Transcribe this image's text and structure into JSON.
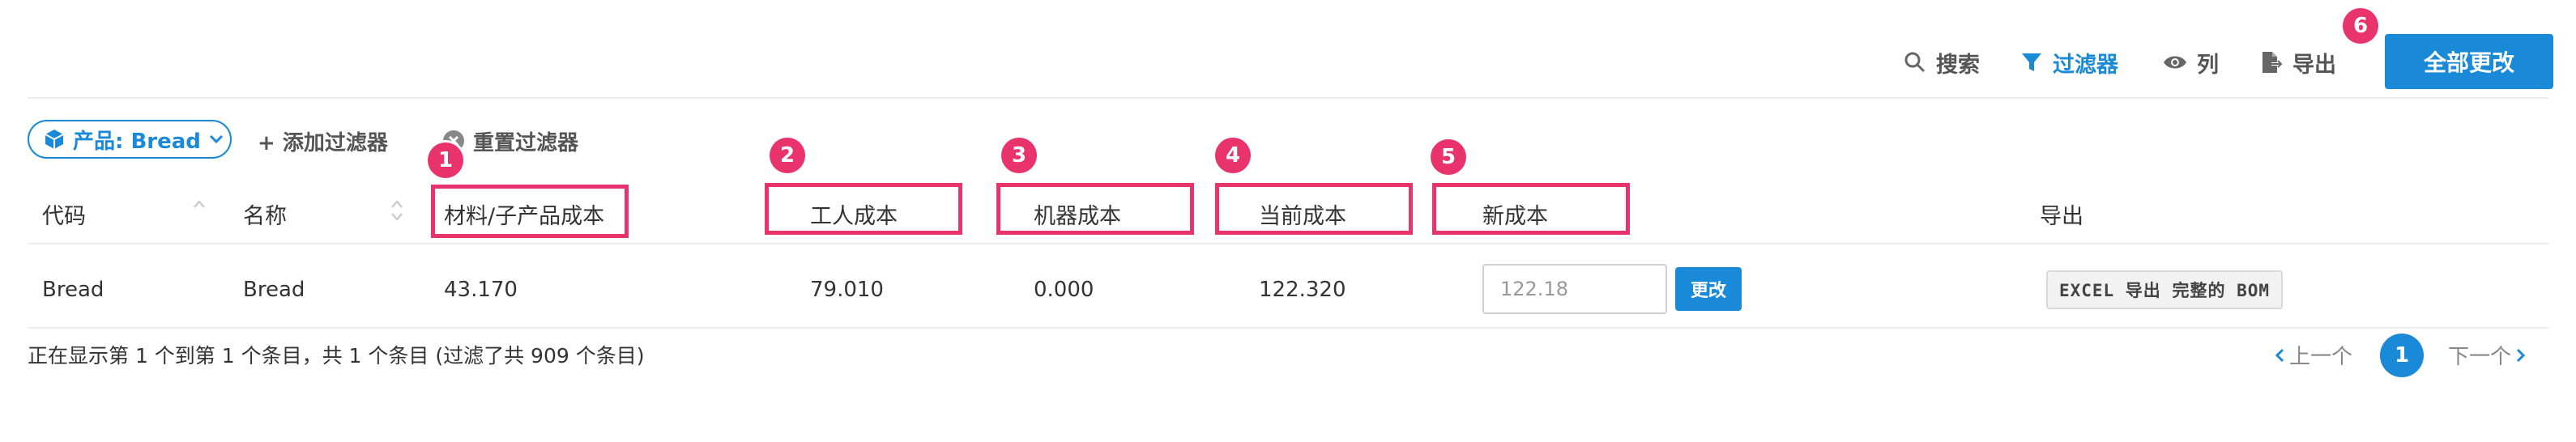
{
  "toolbar": {
    "search_label": "搜索",
    "filter_label": "过滤器",
    "columns_label": "列",
    "export_label": "导出",
    "change_all_label": "全部更改"
  },
  "filters": {
    "chip_label": "产品: Bread",
    "add_filter_label": "+ 添加过滤器",
    "reset_filter_label": "重置过滤器"
  },
  "table": {
    "headers": {
      "code": "代码",
      "name": "名称",
      "material_cost": "材料/子产品成本",
      "labor_cost": "工人成本",
      "machine_cost": "机器成本",
      "current_cost": "当前成本",
      "new_cost": "新成本",
      "export": "导出"
    },
    "rows": [
      {
        "code": "Bread",
        "name": "Bread",
        "material_cost": "43.170",
        "labor_cost": "79.010",
        "machine_cost": "0.000",
        "current_cost": "122.320",
        "new_cost_placeholder": "122.18",
        "update_label": "更改",
        "export_label": "EXCEL 导出 完整的 BOM"
      }
    ]
  },
  "annotations": [
    "1",
    "2",
    "3",
    "4",
    "5",
    "6"
  ],
  "footer": {
    "summary": "正在显示第 1 个到第 1 个条目，共 1 个条目 (过滤了共 909 个条目)",
    "prev_label": "上一个",
    "current_page": "1",
    "next_label": "下一个"
  },
  "colors": {
    "accent": "#1a8ad8",
    "highlight": "#e8336d"
  }
}
